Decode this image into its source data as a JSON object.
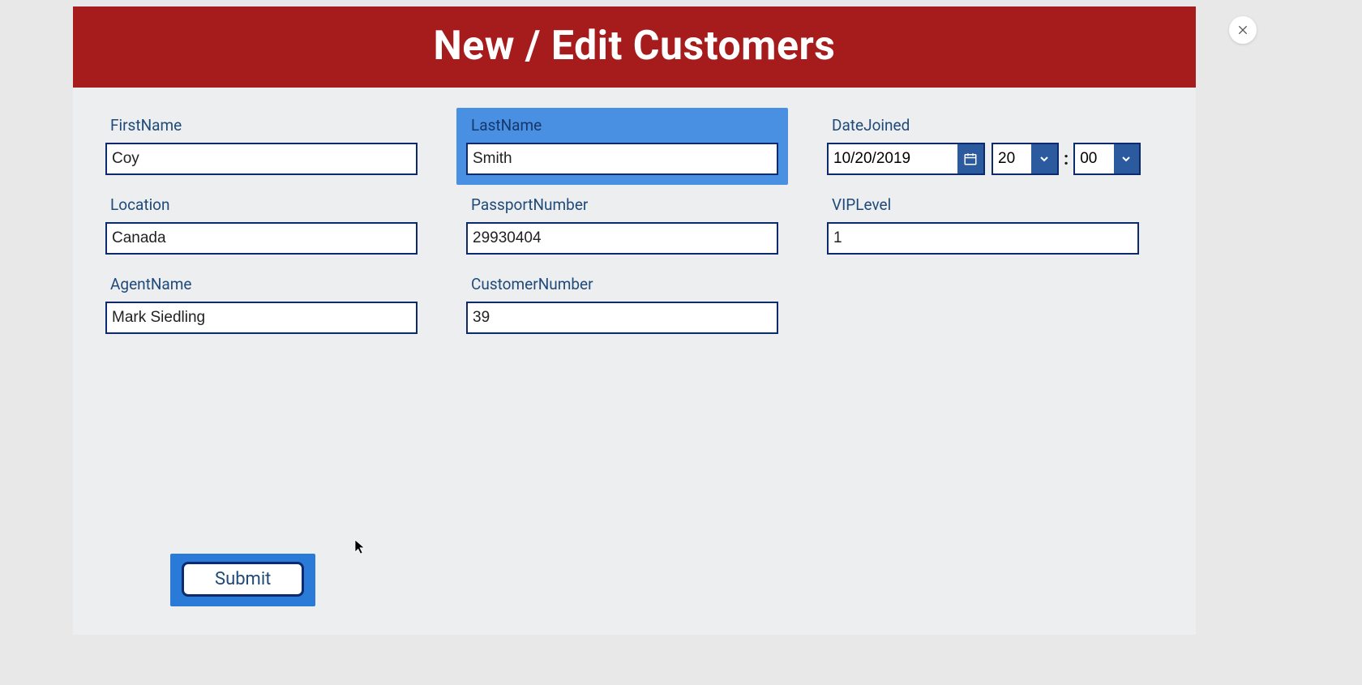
{
  "header": {
    "title": "New / Edit Customers"
  },
  "fields": {
    "firstName": {
      "label": "FirstName",
      "value": "Coy"
    },
    "lastName": {
      "label": "LastName",
      "value": "Smith"
    },
    "dateJoined": {
      "label": "DateJoined",
      "date": "10/20/2019",
      "hour": "20",
      "minute": "00",
      "separator": ":"
    },
    "location": {
      "label": "Location",
      "value": "Canada"
    },
    "passportNumber": {
      "label": "PassportNumber",
      "value": "29930404"
    },
    "vipLevel": {
      "label": "VIPLevel",
      "value": "1"
    },
    "agentName": {
      "label": "AgentName",
      "value": "Mark Siedling"
    },
    "customerNumber": {
      "label": "CustomerNumber",
      "value": "39"
    }
  },
  "actions": {
    "submit": "Submit"
  },
  "colors": {
    "headerBg": "#a61c1c",
    "accent": "#2c5a9e",
    "highlight": "#4a90e2",
    "border": "#0d2a6e",
    "labelText": "#1f4a7a"
  }
}
